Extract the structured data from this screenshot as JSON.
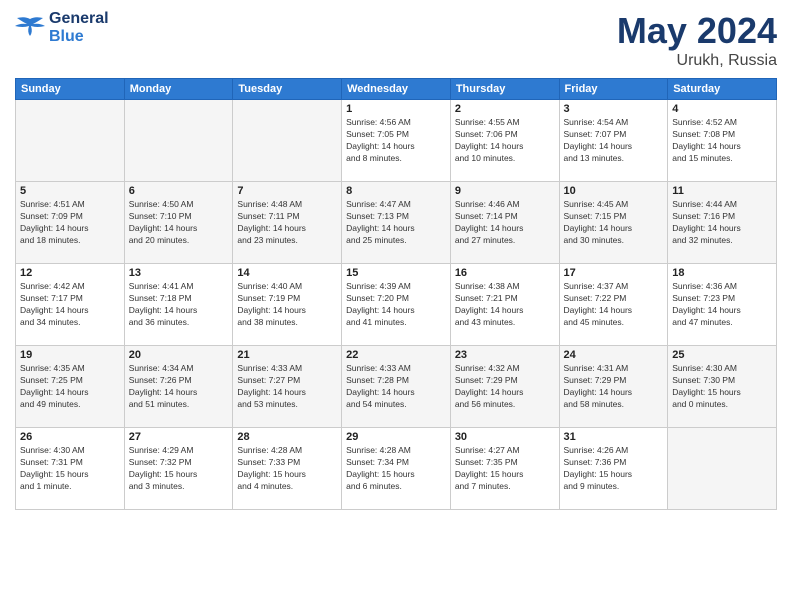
{
  "header": {
    "logo_line1": "General",
    "logo_line2": "Blue",
    "month": "May 2024",
    "location": "Urukh, Russia"
  },
  "weekdays": [
    "Sunday",
    "Monday",
    "Tuesday",
    "Wednesday",
    "Thursday",
    "Friday",
    "Saturday"
  ],
  "rows": [
    [
      {
        "day": "",
        "info": ""
      },
      {
        "day": "",
        "info": ""
      },
      {
        "day": "",
        "info": ""
      },
      {
        "day": "1",
        "info": "Sunrise: 4:56 AM\nSunset: 7:05 PM\nDaylight: 14 hours\nand 8 minutes."
      },
      {
        "day": "2",
        "info": "Sunrise: 4:55 AM\nSunset: 7:06 PM\nDaylight: 14 hours\nand 10 minutes."
      },
      {
        "day": "3",
        "info": "Sunrise: 4:54 AM\nSunset: 7:07 PM\nDaylight: 14 hours\nand 13 minutes."
      },
      {
        "day": "4",
        "info": "Sunrise: 4:52 AM\nSunset: 7:08 PM\nDaylight: 14 hours\nand 15 minutes."
      }
    ],
    [
      {
        "day": "5",
        "info": "Sunrise: 4:51 AM\nSunset: 7:09 PM\nDaylight: 14 hours\nand 18 minutes."
      },
      {
        "day": "6",
        "info": "Sunrise: 4:50 AM\nSunset: 7:10 PM\nDaylight: 14 hours\nand 20 minutes."
      },
      {
        "day": "7",
        "info": "Sunrise: 4:48 AM\nSunset: 7:11 PM\nDaylight: 14 hours\nand 23 minutes."
      },
      {
        "day": "8",
        "info": "Sunrise: 4:47 AM\nSunset: 7:13 PM\nDaylight: 14 hours\nand 25 minutes."
      },
      {
        "day": "9",
        "info": "Sunrise: 4:46 AM\nSunset: 7:14 PM\nDaylight: 14 hours\nand 27 minutes."
      },
      {
        "day": "10",
        "info": "Sunrise: 4:45 AM\nSunset: 7:15 PM\nDaylight: 14 hours\nand 30 minutes."
      },
      {
        "day": "11",
        "info": "Sunrise: 4:44 AM\nSunset: 7:16 PM\nDaylight: 14 hours\nand 32 minutes."
      }
    ],
    [
      {
        "day": "12",
        "info": "Sunrise: 4:42 AM\nSunset: 7:17 PM\nDaylight: 14 hours\nand 34 minutes."
      },
      {
        "day": "13",
        "info": "Sunrise: 4:41 AM\nSunset: 7:18 PM\nDaylight: 14 hours\nand 36 minutes."
      },
      {
        "day": "14",
        "info": "Sunrise: 4:40 AM\nSunset: 7:19 PM\nDaylight: 14 hours\nand 38 minutes."
      },
      {
        "day": "15",
        "info": "Sunrise: 4:39 AM\nSunset: 7:20 PM\nDaylight: 14 hours\nand 41 minutes."
      },
      {
        "day": "16",
        "info": "Sunrise: 4:38 AM\nSunset: 7:21 PM\nDaylight: 14 hours\nand 43 minutes."
      },
      {
        "day": "17",
        "info": "Sunrise: 4:37 AM\nSunset: 7:22 PM\nDaylight: 14 hours\nand 45 minutes."
      },
      {
        "day": "18",
        "info": "Sunrise: 4:36 AM\nSunset: 7:23 PM\nDaylight: 14 hours\nand 47 minutes."
      }
    ],
    [
      {
        "day": "19",
        "info": "Sunrise: 4:35 AM\nSunset: 7:25 PM\nDaylight: 14 hours\nand 49 minutes."
      },
      {
        "day": "20",
        "info": "Sunrise: 4:34 AM\nSunset: 7:26 PM\nDaylight: 14 hours\nand 51 minutes."
      },
      {
        "day": "21",
        "info": "Sunrise: 4:33 AM\nSunset: 7:27 PM\nDaylight: 14 hours\nand 53 minutes."
      },
      {
        "day": "22",
        "info": "Sunrise: 4:33 AM\nSunset: 7:28 PM\nDaylight: 14 hours\nand 54 minutes."
      },
      {
        "day": "23",
        "info": "Sunrise: 4:32 AM\nSunset: 7:29 PM\nDaylight: 14 hours\nand 56 minutes."
      },
      {
        "day": "24",
        "info": "Sunrise: 4:31 AM\nSunset: 7:29 PM\nDaylight: 14 hours\nand 58 minutes."
      },
      {
        "day": "25",
        "info": "Sunrise: 4:30 AM\nSunset: 7:30 PM\nDaylight: 15 hours\nand 0 minutes."
      }
    ],
    [
      {
        "day": "26",
        "info": "Sunrise: 4:30 AM\nSunset: 7:31 PM\nDaylight: 15 hours\nand 1 minute."
      },
      {
        "day": "27",
        "info": "Sunrise: 4:29 AM\nSunset: 7:32 PM\nDaylight: 15 hours\nand 3 minutes."
      },
      {
        "day": "28",
        "info": "Sunrise: 4:28 AM\nSunset: 7:33 PM\nDaylight: 15 hours\nand 4 minutes."
      },
      {
        "day": "29",
        "info": "Sunrise: 4:28 AM\nSunset: 7:34 PM\nDaylight: 15 hours\nand 6 minutes."
      },
      {
        "day": "30",
        "info": "Sunrise: 4:27 AM\nSunset: 7:35 PM\nDaylight: 15 hours\nand 7 minutes."
      },
      {
        "day": "31",
        "info": "Sunrise: 4:26 AM\nSunset: 7:36 PM\nDaylight: 15 hours\nand 9 minutes."
      },
      {
        "day": "",
        "info": ""
      }
    ]
  ],
  "colors": {
    "header_bg": "#2e7ad1",
    "logo_blue": "#1a3a6c",
    "accent": "#2e7ad1"
  }
}
